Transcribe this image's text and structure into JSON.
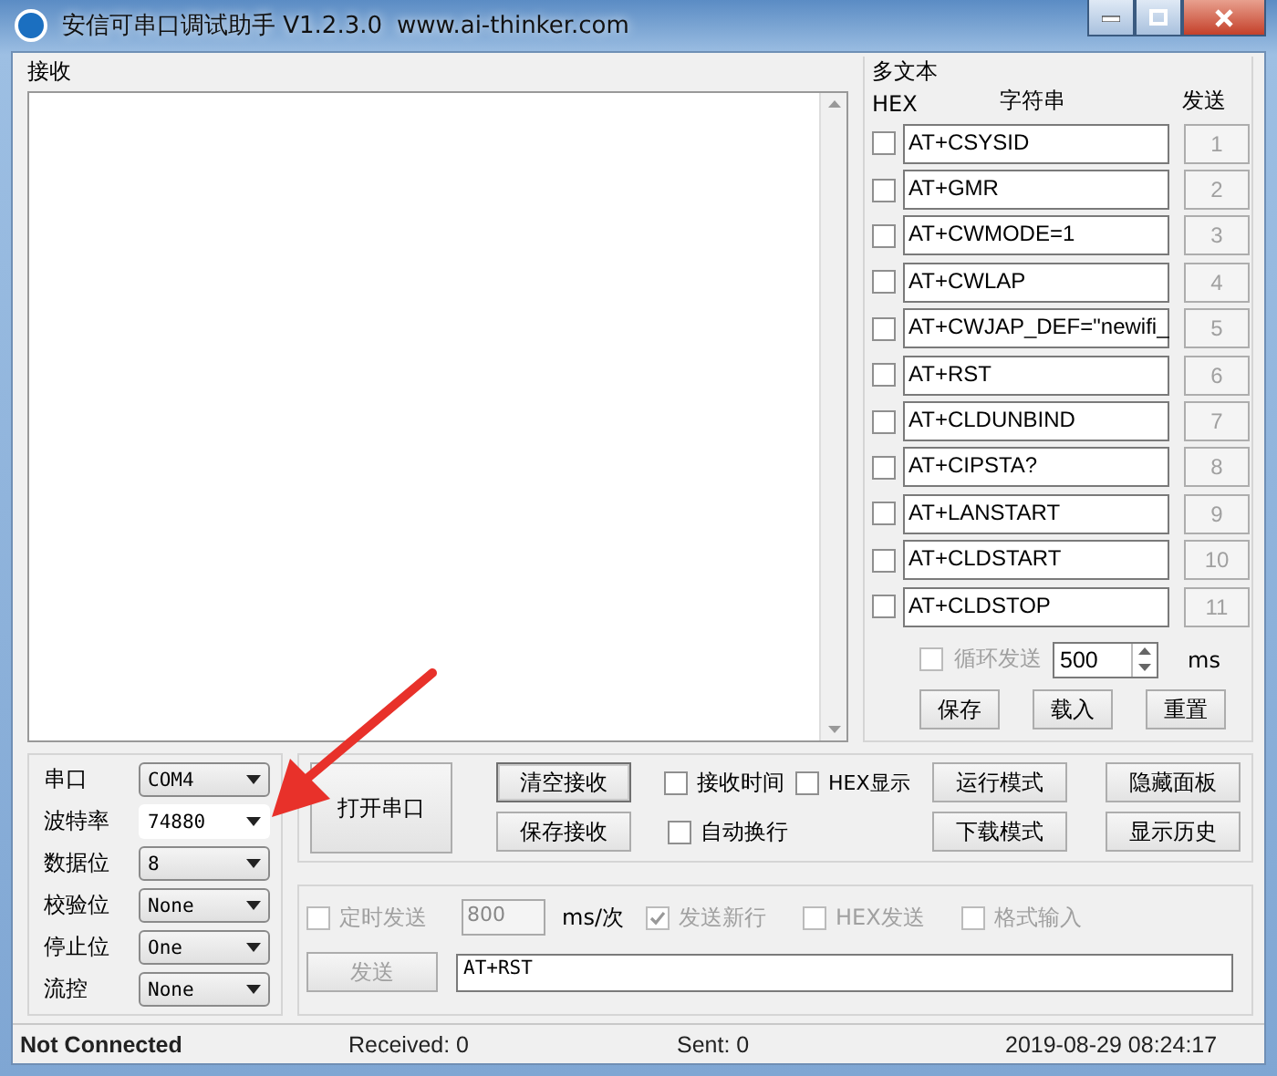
{
  "window": {
    "title": "安信可串口调试助手 V1.2.3.0",
    "url": "www.ai-thinker.com"
  },
  "receive": {
    "label": "接收"
  },
  "multi_text": {
    "label": "多文本",
    "col_hex": "HEX",
    "col_string": "字符串",
    "col_send": "发送",
    "buttons_disabled": true,
    "rows": [
      {
        "hex_checked": false,
        "command": "AT+CSYSID",
        "button": "1"
      },
      {
        "hex_checked": false,
        "command": "AT+GMR",
        "button": "2"
      },
      {
        "hex_checked": false,
        "command": "AT+CWMODE=1",
        "button": "3"
      },
      {
        "hex_checked": false,
        "command": "AT+CWLAP",
        "button": "4"
      },
      {
        "hex_checked": false,
        "command": "AT+CWJAP_DEF=\"newifi_",
        "button": "5"
      },
      {
        "hex_checked": false,
        "command": "AT+RST",
        "button": "6"
      },
      {
        "hex_checked": false,
        "command": "AT+CLDUNBIND",
        "button": "7"
      },
      {
        "hex_checked": false,
        "command": "AT+CIPSTA?",
        "button": "8"
      },
      {
        "hex_checked": false,
        "command": "AT+LANSTART",
        "button": "9"
      },
      {
        "hex_checked": false,
        "command": "AT+CLDSTART",
        "button": "10"
      },
      {
        "hex_checked": false,
        "command": "AT+CLDSTOP",
        "button": "11"
      }
    ],
    "loop_send": {
      "label": "循环发送",
      "checked": false,
      "interval": "500",
      "unit": "ms"
    },
    "buttons": [
      "保存",
      "载入",
      "重置"
    ]
  },
  "serial": [
    {
      "label": "串口",
      "value": "COM4",
      "kind": "select"
    },
    {
      "label": "波特率",
      "value": "74880",
      "kind": "combo"
    },
    {
      "label": "数据位",
      "value": "8",
      "kind": "select"
    },
    {
      "label": "校验位",
      "value": "None",
      "kind": "select"
    },
    {
      "label": "停止位",
      "value": "One",
      "kind": "select"
    },
    {
      "label": "流控",
      "value": "None",
      "kind": "select"
    }
  ],
  "open_button": "打开串口",
  "receive_options": {
    "clear": "清空接收",
    "save": "保存接收",
    "checks": [
      {
        "label": "接收时间",
        "checked": false
      },
      {
        "label": "HEX显示",
        "checked": false
      },
      {
        "label": "自动换行",
        "checked": false
      }
    ],
    "mode_buttons": [
      "运行模式",
      "下载模式"
    ],
    "panel_buttons": [
      "隐藏面板",
      "显示历史"
    ]
  },
  "send": {
    "disabled": true,
    "timed": {
      "label": "定时发送",
      "checked": false
    },
    "interval": "800",
    "unit": "ms/次",
    "options": [
      {
        "label": "发送新行",
        "checked": true
      },
      {
        "label": "HEX发送",
        "checked": false
      },
      {
        "label": "格式输入",
        "checked": false
      }
    ],
    "button": "发送",
    "text": "AT+RST"
  },
  "status": {
    "connection": "Not Connected",
    "received": "Received: 0",
    "sent": "Sent: 0",
    "time": "2019-08-29 08:24:17"
  }
}
